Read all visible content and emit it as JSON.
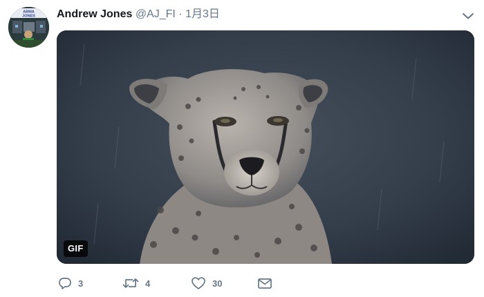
{
  "tweet": {
    "author_name": "Andrew Jones",
    "author_handle": "@AJ_FI",
    "separator": "·",
    "date": "1月3日",
    "avatar_text": "ABMA JONES",
    "media": {
      "badge": "GIF",
      "subject": "cheetah"
    },
    "actions": {
      "reply_count": "3",
      "retweet_count": "4",
      "like_count": "30"
    }
  },
  "colors": {
    "text_primary": "#14171a",
    "text_secondary": "#657786",
    "media_bg": "#2d3846"
  }
}
